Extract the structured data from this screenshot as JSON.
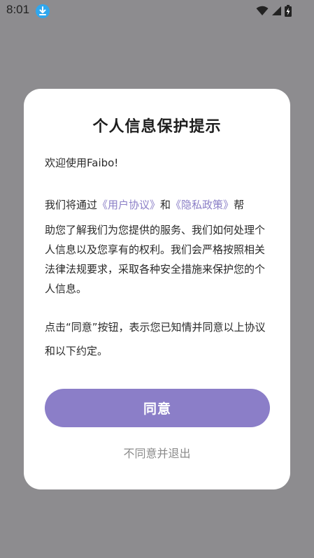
{
  "status_bar": {
    "time": "8:01",
    "download_icon": "download-icon",
    "wifi_icon": "wifi-icon",
    "signal_icon": "signal-icon",
    "battery_icon": "battery-charging-icon"
  },
  "dialog": {
    "title": "个人信息保护提示",
    "greeting": "欢迎使用Faibo!",
    "para1_prefix": "我们将通过",
    "user_agreement_link": "《用户协议》",
    "and_text": "和",
    "privacy_policy_link": "《隐私政策》",
    "para1_suffix": "帮",
    "para1_rest": "助您了解我们为您提供的服务、我们如何处理个人信息以及您享有的权利。我们会严格按照相关法律法规要求，采取各种安全措施来保护您的个人信息。",
    "para2": "点击“同意”按钮，表示您已知情并同意以上协议和以下约定。",
    "agree_button": "同意",
    "disagree_link": "不同意并退出"
  },
  "colors": {
    "overlay": "#8d8c8f",
    "accent": "#8b7ec8",
    "link": "#8b7fc7",
    "download_badge": "#2fa7ee"
  }
}
